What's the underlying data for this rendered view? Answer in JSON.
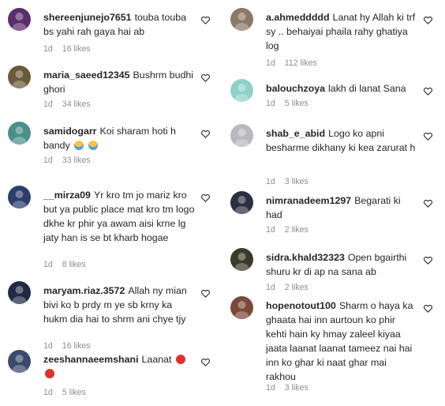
{
  "left_comments": [
    {
      "username": "shereenjunejo7651",
      "text": "touba touba bs yahi rah gaya hai ab",
      "emoji": "",
      "time": "1d",
      "likes": "16 likes",
      "avatar_color": "#5a2d6b"
    },
    {
      "username": "maria_saeed12345",
      "text": "Bushrm budhi ghori",
      "emoji": "",
      "time": "1d",
      "likes": "34 likes",
      "avatar_color": "#6b5a3a"
    },
    {
      "username": "samidogarr",
      "text": "Koi sharam hoti h bandy",
      "emoji": "fear-fear",
      "time": "1d",
      "likes": "33 likes",
      "avatar_color": "#4a8f8a"
    },
    {
      "username": "__mirza09",
      "text": "Yr kro tm jo mariz kro but ya public place mat kro tm logo dkhe kr phir ya awam aisi krne lg jaty han is se bt kharb hogae",
      "emoji": "",
      "time": "1d",
      "likes": "8 likes",
      "avatar_color": "#2c3e6b"
    },
    {
      "username": "maryam.riaz.3572",
      "text": "Allah ny mian bivi ko b prdy m ye sb krny ka hukm dia hai to shrm ani chye tjy",
      "emoji": "",
      "time": "1d",
      "likes": "16 likes",
      "avatar_color": "#1f2a44"
    },
    {
      "username": "zeeshannaeemshani",
      "text": "Laanat",
      "emoji": "angry-angry",
      "time": "1d",
      "likes": "5 likes",
      "avatar_color": "#3a4a6b"
    }
  ],
  "right_comments": [
    {
      "username": "a.ahmeddddd",
      "text": "Lanat hy Allah ki trf sy .. behaiyai phaila rahy ghatiya log",
      "emoji": "",
      "time": "1d",
      "likes": "112 likes",
      "avatar_color": "#8a7a63"
    },
    {
      "username": "balouchzoya",
      "text": "lakh di lanat Sana",
      "emoji": "",
      "time": "1d",
      "likes": "5 likes",
      "avatar_color": "#8fd1c9"
    },
    {
      "username": "shab_e_abid",
      "text": "Logo ko apni besharme dikhany ki kea zarurat h",
      "emoji": "",
      "time": "1d",
      "likes": "3 likes",
      "avatar_color": "#b8b8c0"
    },
    {
      "username": "nimranadeem1297",
      "text": "Begarati ki had",
      "emoji": "",
      "time": "1d",
      "likes": "2 likes",
      "avatar_color": "#2b2f42"
    },
    {
      "username": "sidra.khald32323",
      "text": "Open bgairthi shuru kr di ap na sana ab",
      "emoji": "",
      "time": "1d",
      "likes": "2 likes",
      "avatar_color": "#3a3a2a"
    },
    {
      "username": "hopenotout100",
      "text": "Sharm o haya ka ghaata hai inn aurtoun ko phir kehti hain ky hmay zaleel kiyaa jaata laanat laanat tameez nai hai inn ko ghar ki naat ghar mai rakhou",
      "emoji": "",
      "time": "1d",
      "likes": "3 likes",
      "avatar_color": "#7a4a38"
    }
  ],
  "colors": {
    "text": "#262626",
    "meta": "#8e8e8e",
    "heart_stroke": "#262626"
  },
  "icons": {
    "heart": "heart-outline-icon",
    "avatar": "user-avatar"
  }
}
